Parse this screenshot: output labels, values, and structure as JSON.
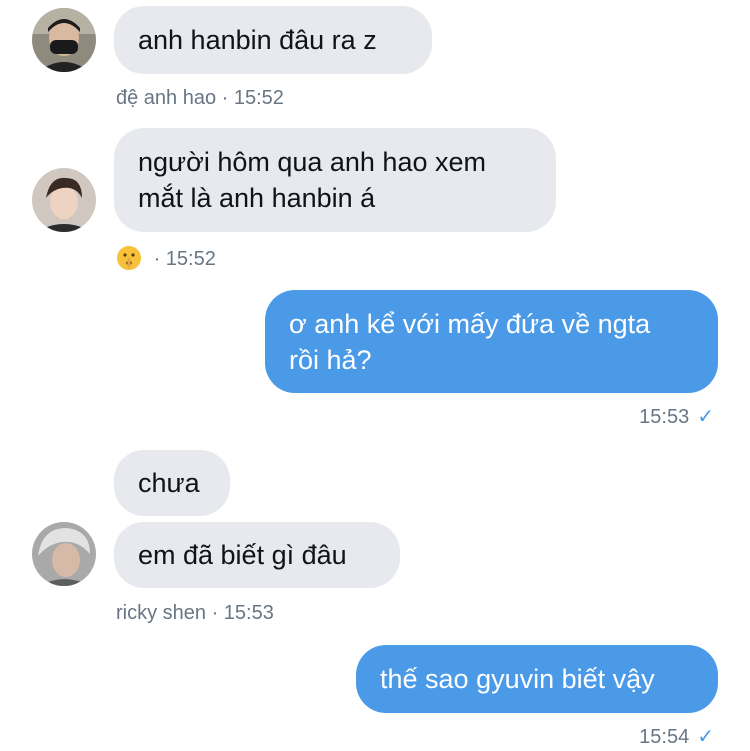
{
  "conversation": {
    "messages": [
      {
        "direction": "in",
        "text": "anh hanbin đâu ra z",
        "sender_meta": "đệ anh hao · 15:52"
      },
      {
        "direction": "in",
        "lines": [
          "người hôm qua anh hao xem",
          "mắt là anh hanbin á"
        ],
        "reaction_icon": "shushing-face-emoji",
        "time_meta": "· 15:52"
      },
      {
        "direction": "out",
        "lines": [
          "ơ anh kể với mấy đứa về ngta",
          "rồi hả?"
        ],
        "time": "15:53",
        "status_icon": "read-check-icon"
      },
      {
        "direction": "in",
        "text": "chưa"
      },
      {
        "direction": "in",
        "text": "em đã biết gì đâu",
        "sender_meta": "ricky shen · 15:53"
      },
      {
        "direction": "out",
        "text": "thế sao gyuvin biết vậy",
        "time": "15:54",
        "status_icon": "read-check-icon"
      }
    ],
    "check_glyph": "✓"
  },
  "colors": {
    "incoming_bubble": "#e7e9ef",
    "outgoing_bubble": "#4a9ae8",
    "meta_text": "#687684",
    "check": "#4a9ae8"
  }
}
